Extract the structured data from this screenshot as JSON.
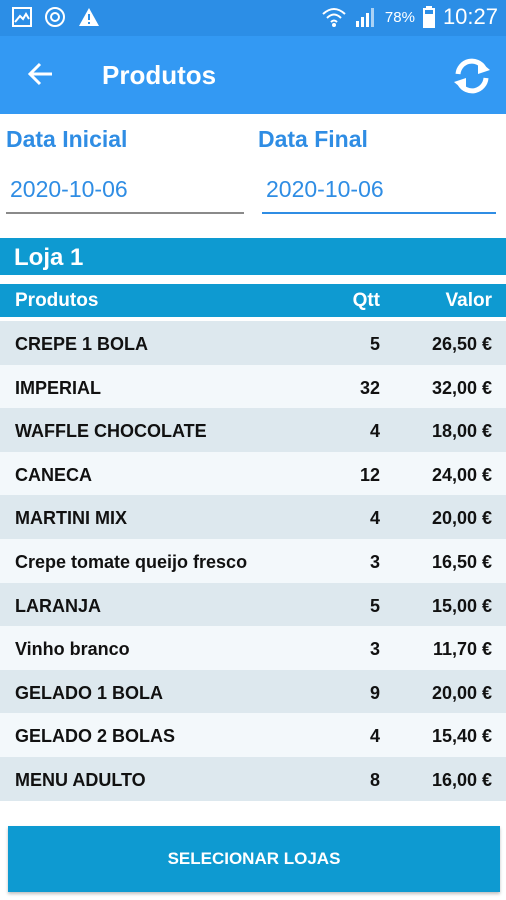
{
  "status_bar": {
    "icons_left": [
      "image-icon",
      "sync-status-icon",
      "warning-icon"
    ],
    "icons_right": [
      "wifi-icon",
      "signal-icon",
      "battery-icon"
    ],
    "battery": "78%",
    "time": "10:27"
  },
  "app_bar": {
    "title": "Produtos",
    "back_icon": "arrow-left-icon",
    "refresh_icon": "refresh-icon"
  },
  "filters": {
    "start_label": "Data Inicial",
    "start_value": "2020-10-06",
    "end_label": "Data Final",
    "end_value": "2020-10-06"
  },
  "store": {
    "name": "Loja 1"
  },
  "table": {
    "headers": {
      "product": "Produtos",
      "qty": "Qtt",
      "value": "Valor"
    },
    "rows": [
      {
        "product": "CREPE 1 BOLA",
        "qty": "5",
        "value": "26,50 €"
      },
      {
        "product": "IMPERIAL",
        "qty": "32",
        "value": "32,00 €"
      },
      {
        "product": "WAFFLE CHOCOLATE",
        "qty": "4",
        "value": "18,00 €"
      },
      {
        "product": "CANECA",
        "qty": "12",
        "value": "24,00 €"
      },
      {
        "product": "MARTINI MIX",
        "qty": "4",
        "value": "20,00 €"
      },
      {
        "product": "Crepe tomate queijo fresco",
        "qty": "3",
        "value": "16,50 €"
      },
      {
        "product": "LARANJA",
        "qty": "5",
        "value": "15,00 €"
      },
      {
        "product": "Vinho branco",
        "qty": "3",
        "value": "11,70 €"
      },
      {
        "product": "GELADO 1 BOLA",
        "qty": "9",
        "value": "20,00 €"
      },
      {
        "product": "GELADO 2 BOLAS",
        "qty": "4",
        "value": "15,40 €"
      },
      {
        "product": "MENU ADULTO",
        "qty": "8",
        "value": "16,00 €"
      }
    ]
  },
  "actions": {
    "select_stores": "SELECIONAR LOJAS"
  },
  "colors": {
    "status_bar": "#2c8ee6",
    "app_bar": "#3399f3",
    "accent_text": "#2f8de4",
    "table_header": "#0e9ad1",
    "row_odd": "#dde8ee",
    "row_even": "#f3f8fb"
  }
}
